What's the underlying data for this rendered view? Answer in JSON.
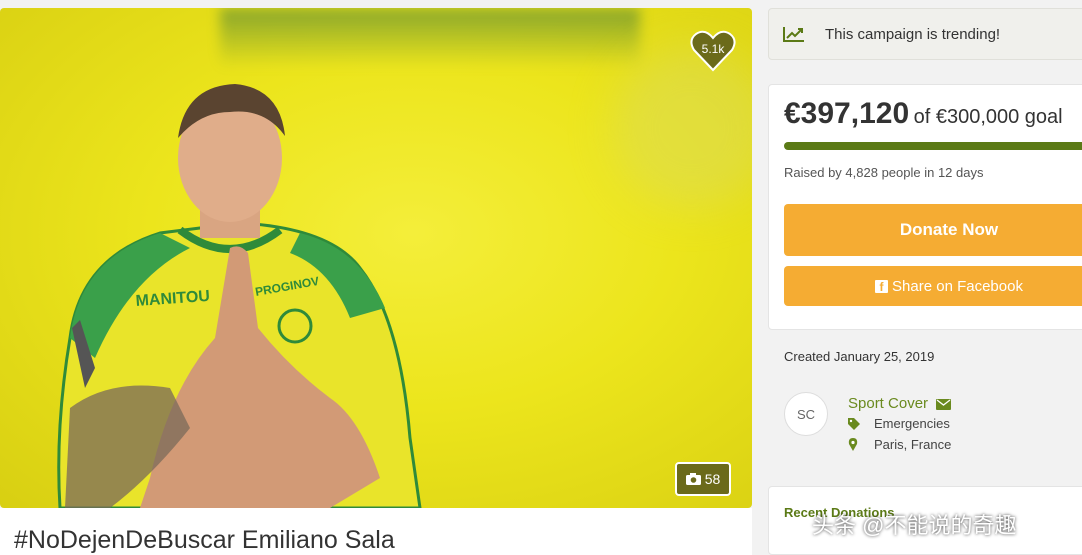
{
  "hero": {
    "like_count": "5.1k",
    "photo_count": "58"
  },
  "campaign": {
    "title": "#NoDejenDeBuscar Emiliano Sala"
  },
  "trending": {
    "text": "This campaign is trending!",
    "icon": "trend-chart-icon"
  },
  "donation": {
    "amount": "€397,120",
    "goal_text": "of €300,000 goal",
    "progress_fraction": 1.0,
    "raised_by": "Raised by 4,828 people in 12 days",
    "donate_label": "Donate Now",
    "share_label": "Share on Facebook"
  },
  "details": {
    "created": "Created January 25, 2019",
    "avatar_initials": "SC",
    "organizer": "Sport Cover",
    "category": "Emergencies",
    "location": "Paris, France"
  },
  "recent": {
    "label": "Recent Donations"
  },
  "watermark": {
    "text": "头条 @不能说的奇趣"
  },
  "colors": {
    "accent_green": "#5b7a16",
    "button_orange": "#f5ac33",
    "hero_yellow": "#ece51c"
  }
}
